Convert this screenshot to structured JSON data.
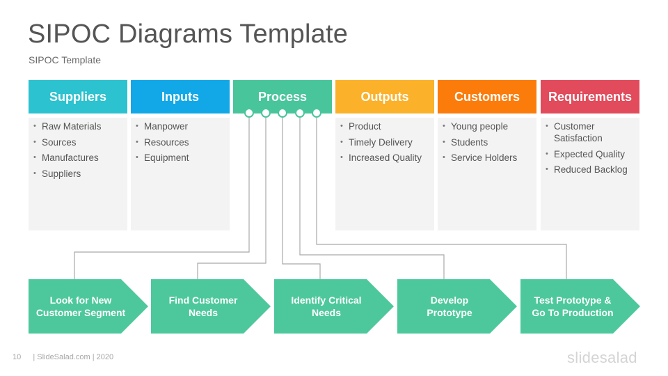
{
  "header": {
    "title": "SIPOC Diagrams Template",
    "subtitle": "SIPOC Template"
  },
  "columns": [
    {
      "label": "Suppliers",
      "color": "#2cc2cf",
      "items": [
        "Raw Materials",
        "Sources",
        "Manufactures",
        "Suppliers"
      ]
    },
    {
      "label": "Inputs",
      "color": "#12a8e7",
      "items": [
        "Manpower",
        "Resources",
        "Equipment"
      ]
    },
    {
      "label": "Process",
      "color": "#49c59b",
      "items": []
    },
    {
      "label": "Outputs",
      "color": "#fbb12a",
      "items": [
        "Product",
        "Timely Delivery",
        "Increased Quality"
      ]
    },
    {
      "label": "Customers",
      "color": "#fb7c0b",
      "items": [
        "Young people",
        "Students",
        "Service Holders"
      ]
    },
    {
      "label": "Requirements",
      "color": "#e14b5b",
      "items": [
        "Customer Satisfaction",
        "Expected Quality",
        "Reduced Backlog"
      ]
    }
  ],
  "process_steps": [
    {
      "line1": "Look for New",
      "line2": "Customer Segment"
    },
    {
      "line1": "Find Customer",
      "line2": "Needs"
    },
    {
      "line1": "Identify Critical",
      "line2": "Needs"
    },
    {
      "line1": "Develop",
      "line2": "Prototype"
    },
    {
      "line1": "Test Prototype &",
      "line2": "Go To Production"
    }
  ],
  "step_color": "#4dc89c",
  "connector_color": "#a9a9a9",
  "footer": {
    "page_number": "10",
    "credit": "| SlideSalad.com | 2020",
    "logo": "slidesalad"
  }
}
